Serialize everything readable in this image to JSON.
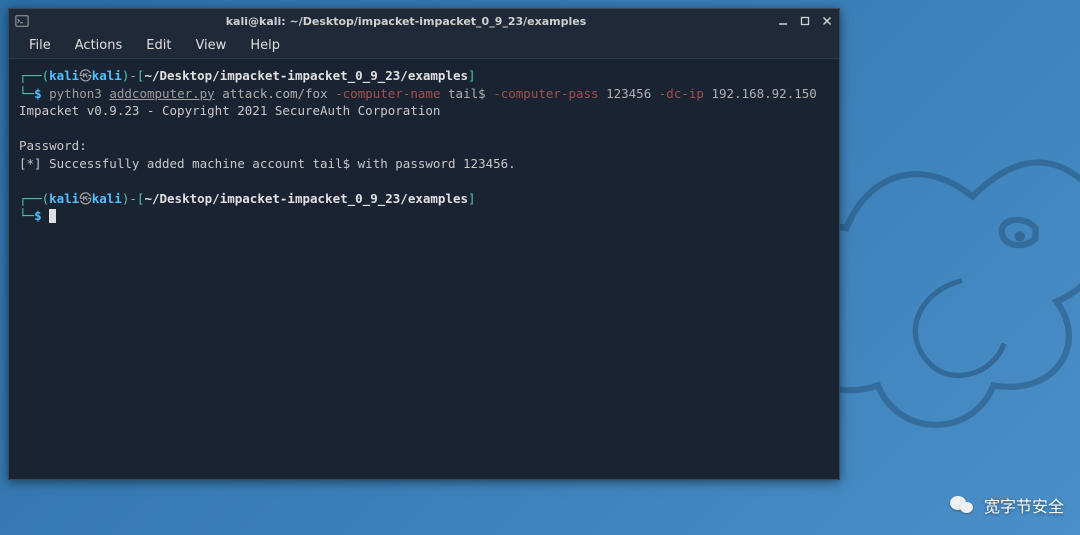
{
  "window": {
    "title": "kali@kali: ~/Desktop/impacket-impacket_0_9_23/examples"
  },
  "menubar": {
    "items": [
      {
        "label": "File"
      },
      {
        "label": "Actions"
      },
      {
        "label": "Edit"
      },
      {
        "label": "View"
      },
      {
        "label": "Help"
      }
    ]
  },
  "prompt": {
    "open_paren": "┌──(",
    "user": "kali",
    "at": "㉿",
    "host": "kali",
    "close_paren": ")",
    "dash": "-",
    "path_open": "[",
    "path": "~/Desktop/impacket-impacket_0_9_23/examples",
    "path_close": "]",
    "line2_prefix": "└─",
    "dollar": "$"
  },
  "command": {
    "binary": "python3",
    "script": "addcomputer.py",
    "target": "attack.com/fox",
    "flag1": "-computer-name",
    "arg1": "tail$",
    "flag2": "-computer-pass",
    "arg2": "123456",
    "flag3": "-dc-ip",
    "arg3": "192.168.92.150"
  },
  "output": {
    "line1": "Impacket v0.9.23 - Copyright 2021 SecureAuth Corporation",
    "line2": "",
    "line3": "Password:",
    "line4": "[*] Successfully added machine account tail$ with password 123456."
  },
  "watermark": {
    "text": "宽字节安全"
  }
}
